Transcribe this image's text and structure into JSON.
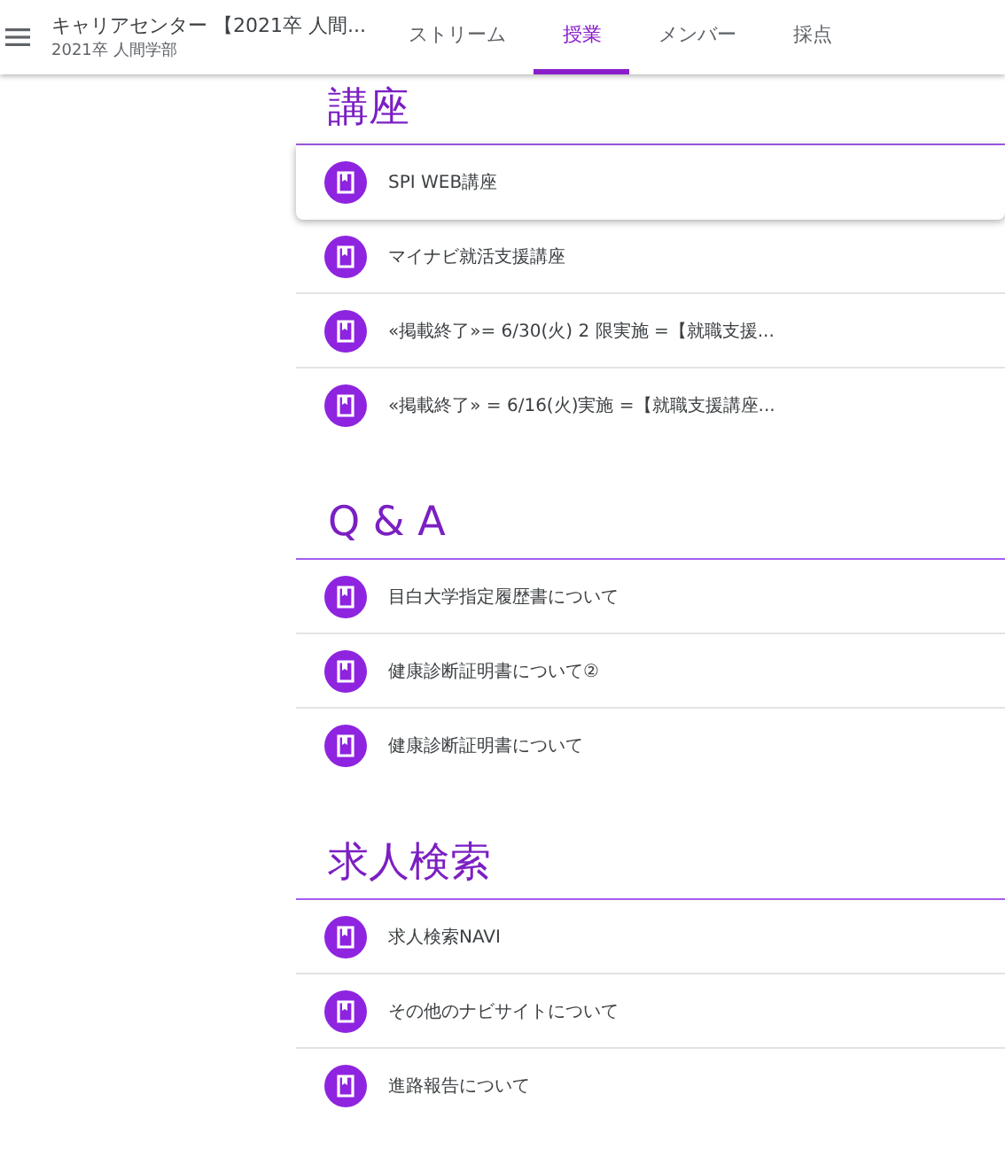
{
  "header": {
    "title": "キャリアセンター 【2021卒 人間...",
    "subtitle": "2021卒 人間学部"
  },
  "tabs": [
    {
      "label": "ストリーム",
      "selected": false
    },
    {
      "label": "授業",
      "selected": true
    },
    {
      "label": "メンバー",
      "selected": false
    },
    {
      "label": "採点",
      "selected": false
    }
  ],
  "sections": [
    {
      "title": "講座",
      "items": [
        {
          "title": "SPI WEB講座",
          "highlighted": true
        },
        {
          "title": "マイナビ就活支援講座",
          "highlighted": false
        },
        {
          "title": "«掲載終了»= 6/30(火) 2 限実施 =【就職支援...",
          "highlighted": false
        },
        {
          "title": "«掲載終了» = 6/16(火)実施 =【就職支援講座...",
          "highlighted": false
        }
      ]
    },
    {
      "title": "Q & A",
      "items": [
        {
          "title": "目白大学指定履歴書について",
          "highlighted": false
        },
        {
          "title": "健康診断証明書について②",
          "highlighted": false
        },
        {
          "title": "健康診断証明書について",
          "highlighted": false
        }
      ]
    },
    {
      "title": "求人検索",
      "items": [
        {
          "title": "求人検索NAVI",
          "highlighted": false
        },
        {
          "title": "その他のナビサイトについて",
          "highlighted": false
        },
        {
          "title": "進路報告について",
          "highlighted": false
        }
      ]
    }
  ]
}
